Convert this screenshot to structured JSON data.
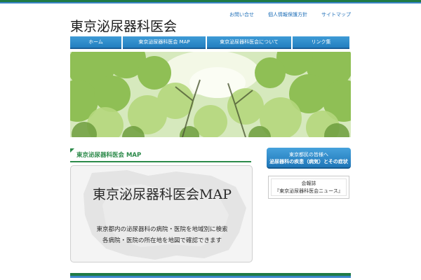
{
  "site": {
    "title": "東京泌尿器科医会"
  },
  "util_links": [
    {
      "label": "お問い合せ"
    },
    {
      "label": "個人情報保護方針"
    },
    {
      "label": "サイトマップ"
    }
  ],
  "nav": [
    {
      "label": "ホーム"
    },
    {
      "label": "東京泌尿器科医会 MAP"
    },
    {
      "label": "東京泌尿器科医会について"
    },
    {
      "label": "リンク集"
    }
  ],
  "main": {
    "section_heading": "東京泌尿器科医会 MAP",
    "map_card": {
      "title": "東京泌尿器科医会MAP",
      "desc_line1": "東京都内の泌尿器科の病院・医院を地域別に検索",
      "desc_line2": "各病院・医院の所在地を地図で確認できます"
    }
  },
  "sidebar": {
    "info_button": {
      "line1": "東京都民の皆様へ",
      "line2": "泌尿器科の疾患（病気）とその症状"
    },
    "news_box": {
      "line1": "会報誌",
      "line2": "『東京泌尿器科医会ニュース』"
    }
  },
  "colors": {
    "brand_green": "#2c8a4a",
    "nav_blue": "#2a88c8",
    "link_blue": "#1f6fb8"
  }
}
